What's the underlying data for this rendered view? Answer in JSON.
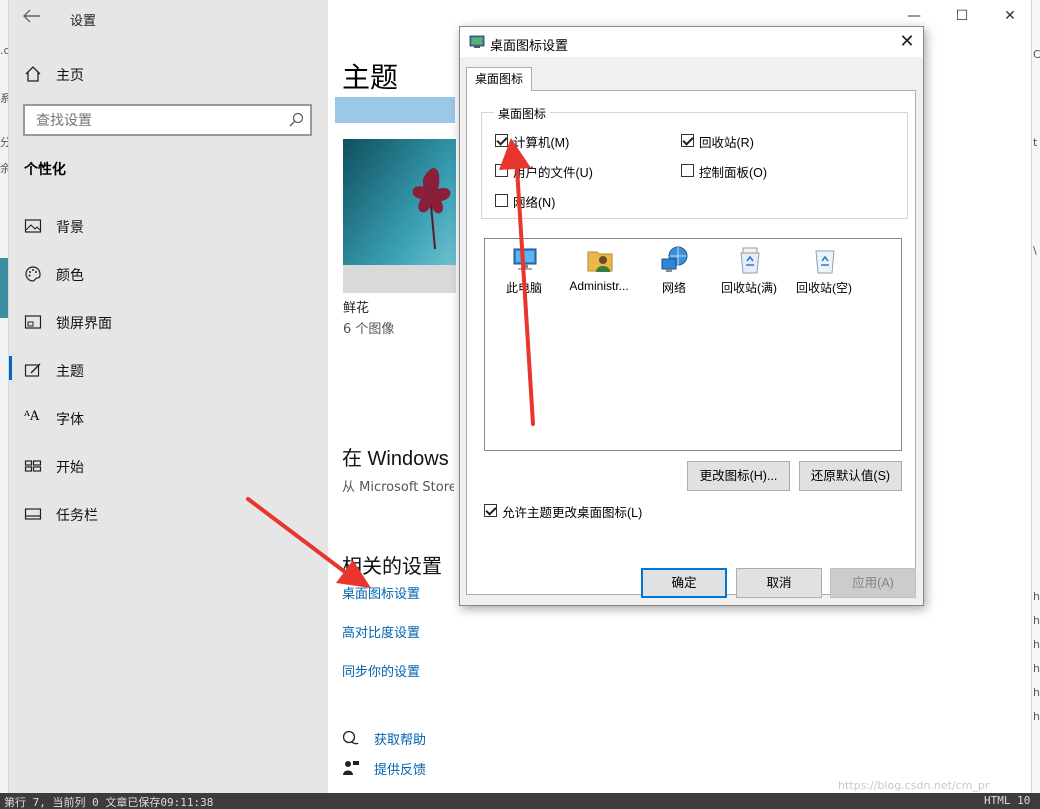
{
  "settings": {
    "title": "设置",
    "search": {
      "placeholder": "查找设置"
    },
    "home_label": "主页",
    "section_title": "个性化",
    "nav_items": [
      {
        "label": "背景",
        "icon": "image-icon"
      },
      {
        "label": "颜色",
        "icon": "palette-icon"
      },
      {
        "label": "锁屏界面",
        "icon": "lock-screen-icon"
      },
      {
        "label": "主题",
        "icon": "theme-icon",
        "active": true
      },
      {
        "label": "字体",
        "icon": "font-icon"
      },
      {
        "label": "开始",
        "icon": "start-icon"
      },
      {
        "label": "任务栏",
        "icon": "taskbar-icon"
      }
    ],
    "window_controls": {
      "minimize": "—",
      "maximize": "☐",
      "close": "✕"
    }
  },
  "main": {
    "title": "主题",
    "theme": {
      "name": "鲜花",
      "count": "6 个图像"
    },
    "store_heading": "在 Windows",
    "store_sub": "从 Microsoft Store",
    "related_heading": "相关的设置",
    "related_links": [
      "桌面图标设置",
      "高对比度设置",
      "同步你的设置"
    ],
    "help": {
      "get_help": "获取帮助",
      "feedback": "提供反馈"
    }
  },
  "dialog": {
    "title": "桌面图标设置",
    "tab": "桌面图标",
    "group_label": "桌面图标",
    "checkboxes": [
      {
        "label": "计算机(M)",
        "checked": true
      },
      {
        "label": "回收站(R)",
        "checked": true
      },
      {
        "label": "用户的文件(U)",
        "checked": false
      },
      {
        "label": "控制面板(O)",
        "checked": false
      },
      {
        "label": "网络(N)",
        "checked": false
      }
    ],
    "icons": [
      {
        "label": "此电脑",
        "icon": "computer-icon"
      },
      {
        "label": "Administr...",
        "icon": "user-folder-icon"
      },
      {
        "label": "网络",
        "icon": "network-icon"
      },
      {
        "label": "回收站(满)",
        "icon": "recycle-bin-full-icon"
      },
      {
        "label": "回收站(空)",
        "icon": "recycle-bin-empty-icon"
      }
    ],
    "change_icon_button": "更改图标(H)...",
    "restore_default_button": "还原默认值(S)",
    "allow_themes": {
      "label": "允许主题更改桌面图标(L)",
      "checked": true
    },
    "ok_button": "确定",
    "cancel_button": "取消",
    "apply_button": "应用(A)"
  },
  "background_edges": {
    "status_left": "第行 7, 当前列 0  文章已保存09:11:38",
    "status_right": "HTML  10",
    "watermark": "https://blog.csdn.net/cm_pr"
  }
}
